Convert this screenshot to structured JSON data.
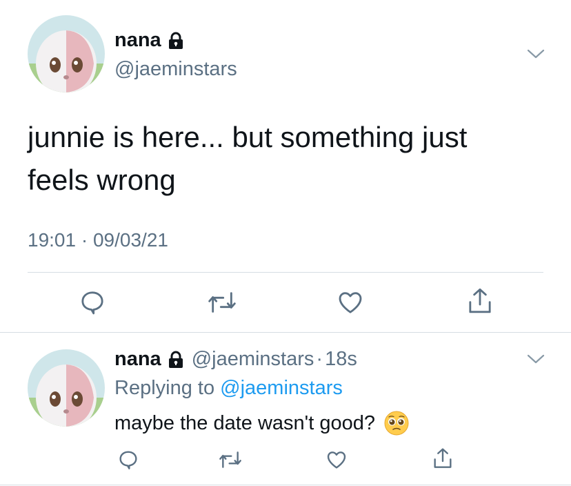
{
  "main_tweet": {
    "author_name": "nana",
    "handle": "@jaeminstars",
    "text": "junnie is here... but something just feels wrong",
    "time": "19:01",
    "separator": "·",
    "date": "09/03/21"
  },
  "reply_tweet": {
    "author_name": "nana",
    "handle": "@jaeminstars",
    "separator": "·",
    "age": "18s",
    "replying_prefix": "Replying to",
    "replying_to": "@jaeminstars",
    "text": "maybe the date wasn't good?"
  },
  "icons": {
    "lock": "lock-icon",
    "chevron": "chevron-down-icon",
    "reply": "reply-icon",
    "retweet": "retweet-icon",
    "like": "heart-icon",
    "share": "share-icon",
    "emoji": "pleading-face-emoji"
  },
  "colors": {
    "text": "#0f1419",
    "secondary": "#5b7083",
    "link": "#1d9bf0",
    "divider": "#d6dde3"
  }
}
